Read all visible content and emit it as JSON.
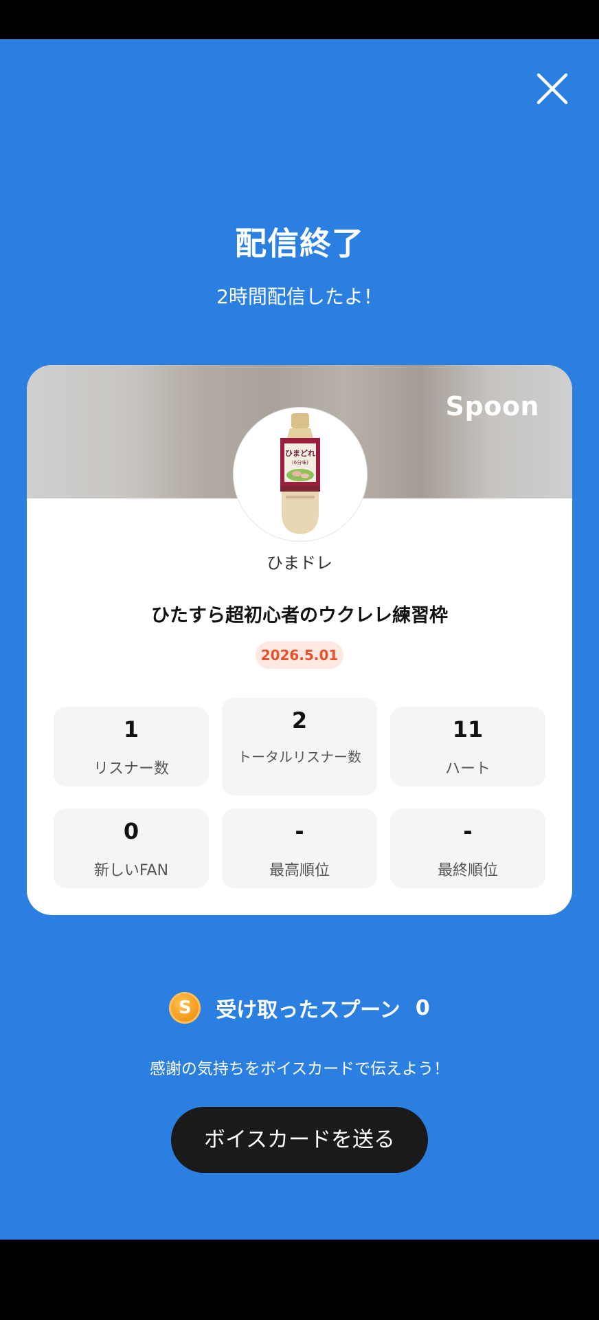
{
  "header": {
    "close_icon": "close-icon",
    "title": "配信終了",
    "subtitle": "2時間配信したよ！"
  },
  "card": {
    "brand": "Spoon",
    "avatar_alt": "ひまドレ",
    "username": "ひまドレ",
    "broadcast_title": "ひたすら超初心者のウクレレ練習枠",
    "date": "2026.5.01",
    "stats": [
      {
        "value": "1",
        "label": "リスナー数"
      },
      {
        "value": "2",
        "label": "トータルリスナー数"
      },
      {
        "value": "11",
        "label": "ハート"
      },
      {
        "value": "0",
        "label": "新しいFAN"
      },
      {
        "value": "-",
        "label": "最高順位"
      },
      {
        "value": "-",
        "label": "最終順位"
      }
    ]
  },
  "spoons": {
    "icon_letter": "S",
    "label": "受け取ったスプーン",
    "count": "0"
  },
  "footer": {
    "prompt": "感謝の気持ちをボイスカードで伝えよう！",
    "button_label": "ボイスカードを送る"
  },
  "colors": {
    "background": "#2A7FE0",
    "date_badge_text": "#E8502A",
    "date_badge_bg": "#FDE8E2",
    "button_bg": "#1A1A1A"
  }
}
